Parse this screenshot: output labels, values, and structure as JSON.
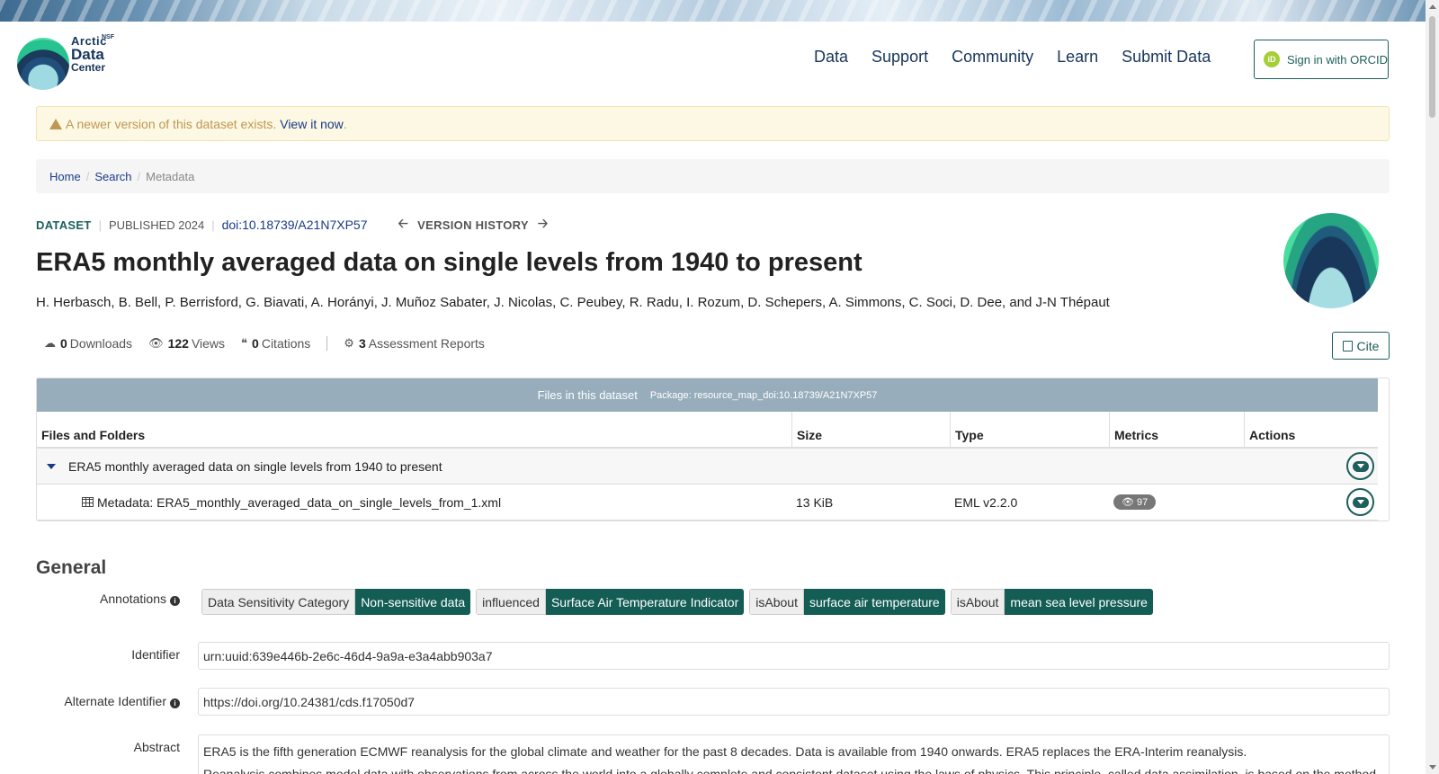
{
  "header": {
    "logo": {
      "nsf": "NSF",
      "line1": "Arctic",
      "line2": "Data",
      "line3": "Center"
    },
    "nav": [
      "Data",
      "Support",
      "Community",
      "Learn",
      "Submit Data"
    ],
    "signin_label": "Sign in with ORCID",
    "orcid_icon_text": "iD"
  },
  "alert": {
    "text": "A newer version of this dataset exists.",
    "link": "View it now",
    "tail": "."
  },
  "breadcrumb": [
    "Home",
    "Search",
    "Metadata"
  ],
  "dataset": {
    "type_label": "DATASET",
    "published": "PUBLISHED 2024",
    "doi": "doi:10.18739/A21N7XP57",
    "version_history": "VERSION HISTORY",
    "title": "ERA5 monthly averaged data on single levels from 1940 to present",
    "authors": "H. Herbasch, B. Bell, P. Berrisford, G. Biavati, A. Horányi, J. Muñoz Sabater, J. Nicolas, C. Peubey, R. Radu, I. Rozum, D. Schepers, A. Simmons, C. Soci, D. Dee, and J-N Thépaut"
  },
  "stats": {
    "downloads": {
      "count": "0",
      "label": "Downloads"
    },
    "views": {
      "count": "122",
      "label": "Views"
    },
    "citations": {
      "count": "0",
      "label": "Citations"
    },
    "assessments": {
      "count": "3",
      "label": "Assessment Reports"
    }
  },
  "cite_label": "Cite",
  "files": {
    "heading": "Files in this dataset",
    "package": "Package: resource_map_doi:10.18739/A21N7XP57",
    "columns": [
      "Files and Folders",
      "Size",
      "Type",
      "Metrics",
      "Actions"
    ],
    "folder": "ERA5 monthly averaged data on single levels from 1940 to present",
    "file": {
      "name": "Metadata: ERA5_monthly_averaged_data_on_single_levels_from_1.xml",
      "size": "13 KiB",
      "type": "EML v2.2.0",
      "views": "97"
    }
  },
  "general": {
    "heading": "General",
    "annotations_label": "Annotations",
    "annotations": [
      {
        "k": "Data Sensitivity Category",
        "v": "Non-sensitive data"
      },
      {
        "k": "influenced",
        "v": "Surface Air Temperature Indicator"
      },
      {
        "k": "isAbout",
        "v": "surface air temperature"
      },
      {
        "k": "isAbout",
        "v": "mean sea level pressure"
      }
    ],
    "identifier_label": "Identifier",
    "identifier": "urn:uuid:639e446b-2e6c-46d4-9a9a-e3a4abb903a7",
    "alt_identifier_label": "Alternate Identifier",
    "alt_identifier": "https://doi.org/10.24381/cds.f17050d7",
    "abstract_label": "Abstract",
    "abstract_1": "ERA5 is the fifth generation ECMWF reanalysis for the global climate and weather for the past 8 decades. Data is available from 1940 onwards. ERA5 replaces the ERA-Interim reanalysis.",
    "abstract_2": "Reanalysis combines model data with observations from across the world into a globally complete and consistent dataset using the laws of physics. This principle, called data assimilation, is based on the method"
  },
  "colors": {
    "brand": "#1c5f5c",
    "link": "#1a3a86",
    "files_header": "#97adbb",
    "annotation_value": "#135d55"
  }
}
